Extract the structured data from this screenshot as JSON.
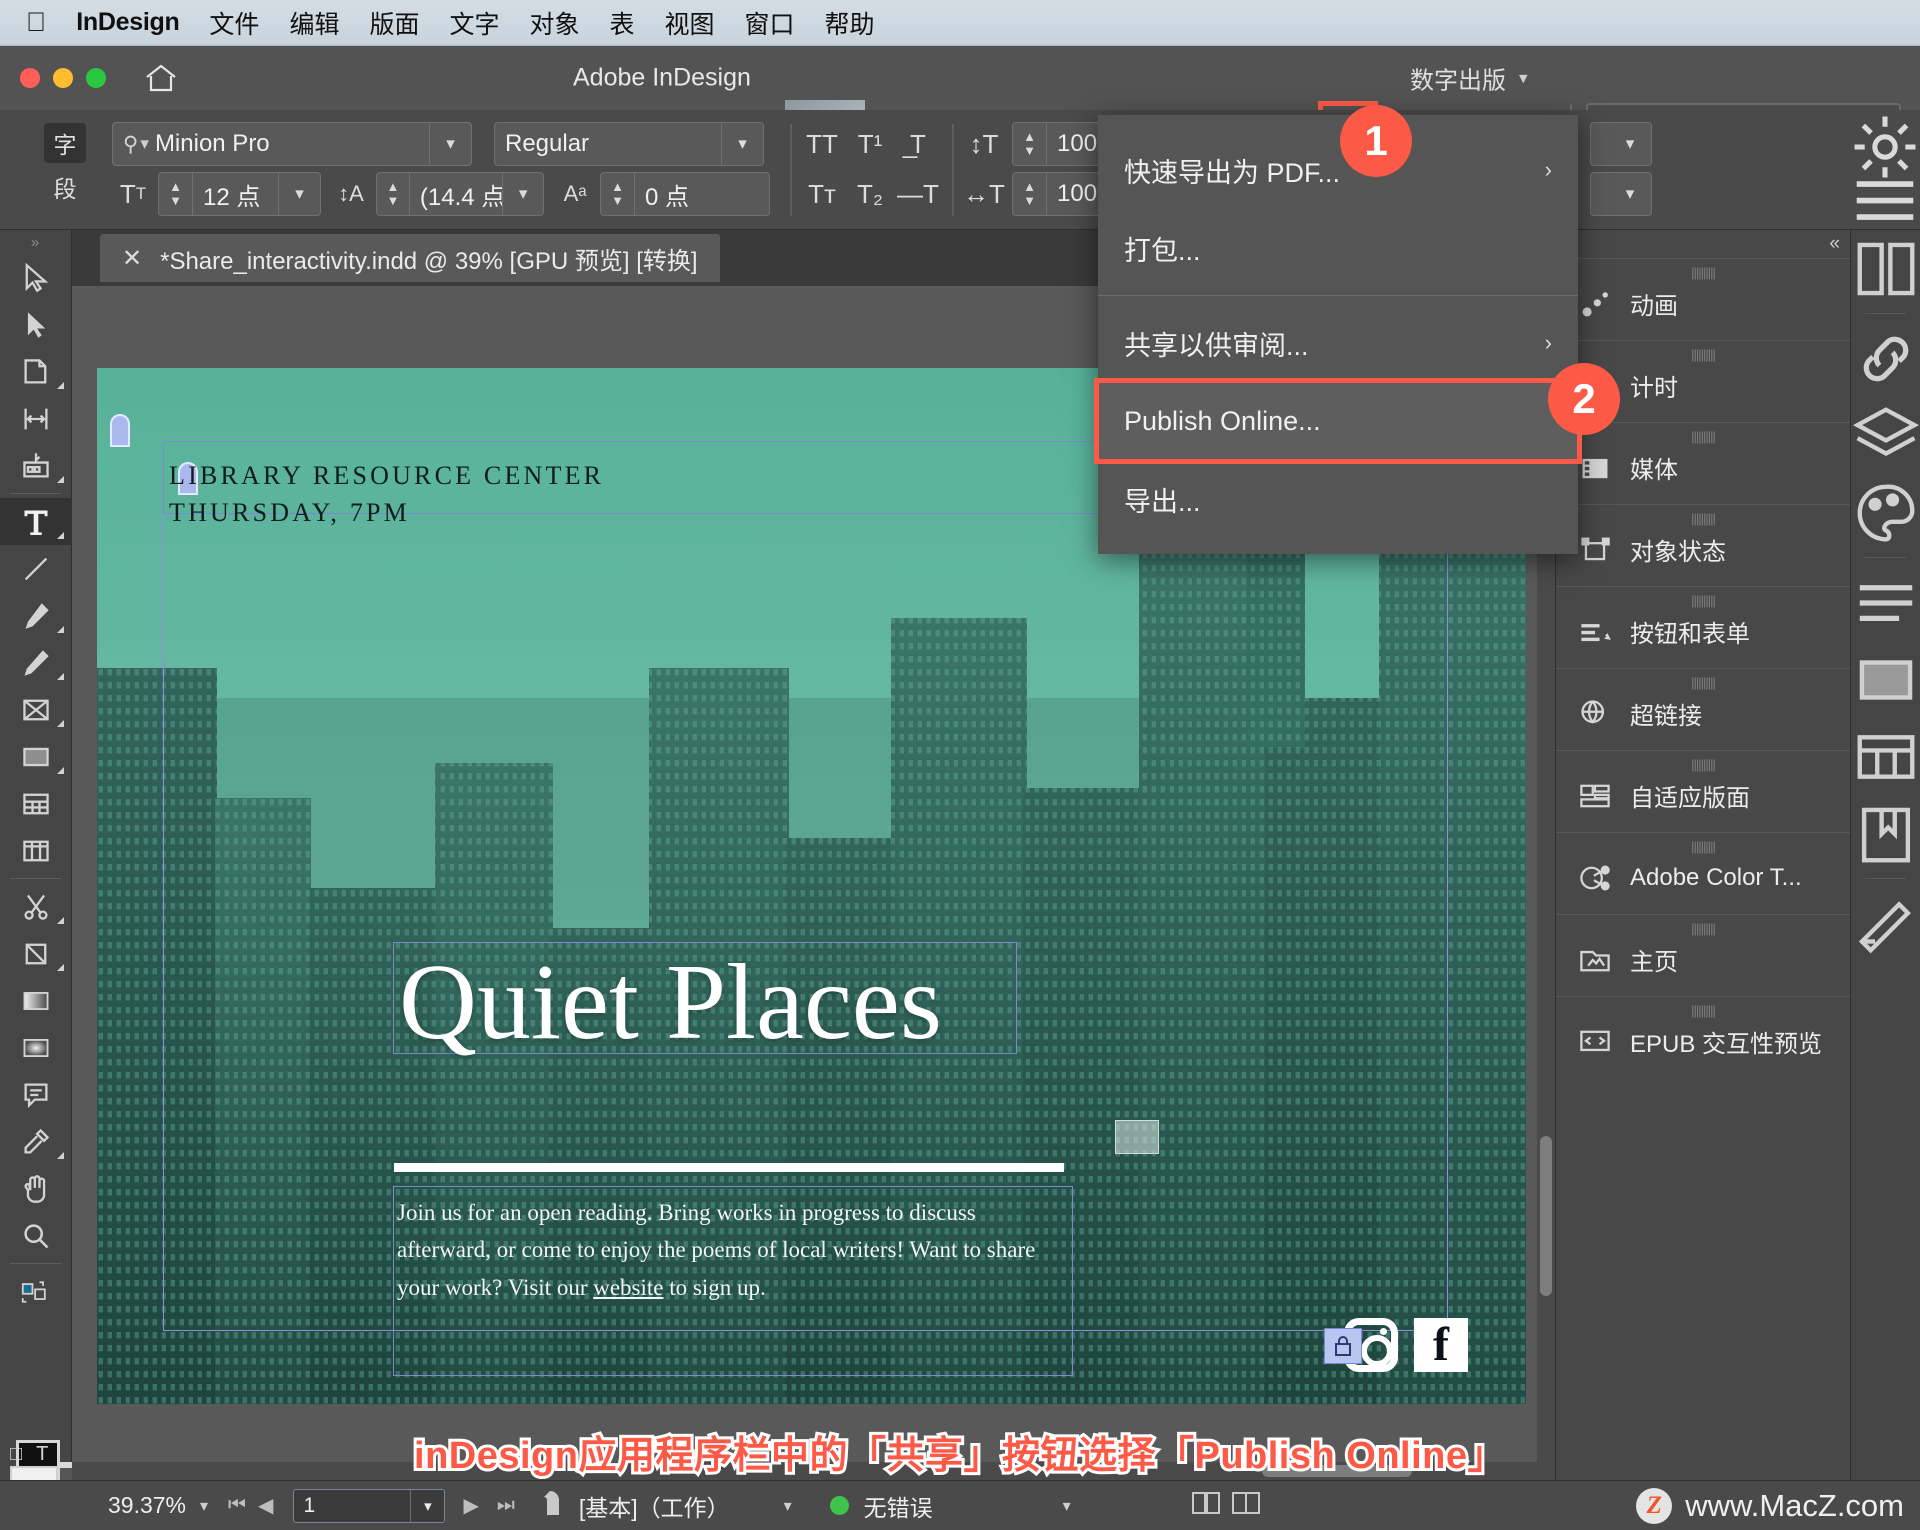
{
  "menubar": {
    "apple_icon": "apple-logo",
    "app_name": "InDesign",
    "items": [
      "文件",
      "编辑",
      "版面",
      "文字",
      "对象",
      "表",
      "视图",
      "窗口",
      "帮助"
    ]
  },
  "titlebar": {
    "title": "Adobe InDesign",
    "share_icon": "share-export-icon",
    "home_icon": "home-icon",
    "workspace": "数字出版",
    "search_placeholder": ""
  },
  "badges": {
    "one": "1",
    "two": "2"
  },
  "controlbar": {
    "mode_char": "字",
    "mode_para": "段",
    "font_family": "Minion Pro",
    "font_style": "Regular",
    "font_size": "12 点",
    "leading": "(14.4 点",
    "kerning": "0 点",
    "vertical_scale": "100%",
    "horizontal_scale": "100%",
    "search_icon": "search-icon",
    "gear_icon": "gear-icon",
    "lightning_icon": "lightning-icon",
    "hamburger_icon": "hamburger-icon"
  },
  "document_tab": {
    "close_icon": "close-icon",
    "label": "*Share_interactivity.indd @ 39% [GPU 预览] [转换]"
  },
  "dropdown": {
    "items": [
      {
        "label": "快速导出为 PDF...",
        "has_submenu": true,
        "highlighted": false
      },
      {
        "label": "打包...",
        "has_submenu": false,
        "highlighted": false
      },
      {
        "label": "共享以供审阅...",
        "has_submenu": true,
        "highlighted": false
      },
      {
        "label": "Publish Online...",
        "has_submenu": false,
        "highlighted": true
      },
      {
        "label": "导出...",
        "has_submenu": false,
        "highlighted": false
      }
    ],
    "submenu_arrow": "chevron-right-icon",
    "highlight_color": "#fc5a47"
  },
  "toolbar": {
    "tools": [
      "selection-tool",
      "direct-selection-tool",
      "page-tool",
      "gap-tool",
      "content-collector-tool",
      "type-tool",
      "line-tool",
      "pen-tool",
      "pencil-tool",
      "frame-tool",
      "rectangle-tool",
      "table-tool",
      "column-tool",
      "scissors-tool",
      "free-transform-tool",
      "gradient-tool",
      "gradient-feather-tool",
      "note-tool",
      "eyedropper-tool",
      "hand-tool",
      "zoom-tool"
    ],
    "selected": "type-tool"
  },
  "poster": {
    "eyebrow_line1": "LIBRARY RESOURCE CENTER",
    "eyebrow_line2": "THURSDAY, 7PM",
    "title": "Quiet Places",
    "body_part1": "Join us for an open reading. Bring works in progress to discuss afterward, or come to enjoy the poems of local writers! Want to share your work? Visit our ",
    "body_link": "website",
    "body_part2": " to sign up.",
    "social": [
      "instagram-icon",
      "facebook-icon"
    ]
  },
  "caption": "inDesign应用程序栏中的「共享」按钮选择「Publish Online」",
  "right_panels": {
    "collapse_icon": "double-chevron-left-icon",
    "items": [
      {
        "label": "动画",
        "icon": "animation-icon"
      },
      {
        "label": "计时",
        "icon": "timing-icon"
      },
      {
        "label": "媒体",
        "icon": "media-icon"
      },
      {
        "label": "对象状态",
        "icon": "object-states-icon"
      },
      {
        "label": "按钮和表单",
        "icon": "buttons-forms-icon"
      },
      {
        "label": "超链接",
        "icon": "hyperlinks-icon"
      },
      {
        "label": "自适应版面",
        "icon": "liquid-layout-icon"
      },
      {
        "label": "Adobe Color T...",
        "icon": "adobe-color-themes-icon"
      },
      {
        "label": "主页",
        "icon": "pages-master-icon"
      },
      {
        "label": "EPUB 交互性预览",
        "icon": "epub-preview-icon"
      }
    ]
  },
  "right_rail": {
    "icons": [
      "pages-icon",
      "links-icon",
      "layers-icon",
      "color-icon",
      "paragraph-styles-icon",
      "swatches-icon",
      "libraries-icon",
      "bookmarks-icon",
      "effects-icon"
    ]
  },
  "statusbar": {
    "zoom": "39.37%",
    "page": "1",
    "preflight_profile": "[基本]（工作）",
    "error_status": "无错误",
    "error_dot_color": "#3fc34a",
    "first_icon": "first-page-icon",
    "prev_icon": "prev-page-icon",
    "next_icon": "next-page-icon",
    "last_icon": "last-page-icon"
  },
  "watermark": {
    "badge": "Z",
    "text": "www.MacZ.com"
  }
}
